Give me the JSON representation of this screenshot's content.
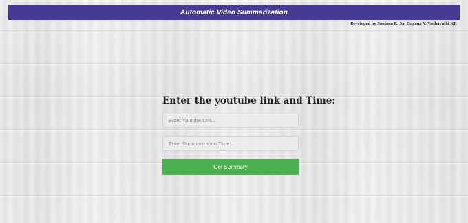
{
  "header": {
    "title": "Automatic Video Summarization",
    "background_color": "#463b93"
  },
  "credit": "Developed by Sanjana R, Sai Gagana V, Vedhavathi KR",
  "form": {
    "heading": "Enter the youtube link and Time:",
    "link_input": {
      "value": "",
      "placeholder": "Enter Youtube Link..."
    },
    "time_input": {
      "value": "",
      "placeholder": "Enter Summarization Time..."
    },
    "submit_label": "Get Summary",
    "submit_color": "#4caf50"
  }
}
